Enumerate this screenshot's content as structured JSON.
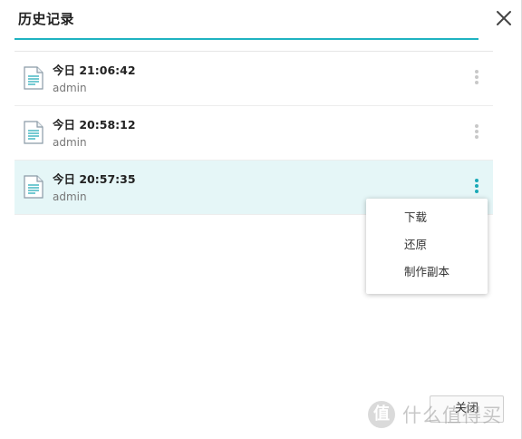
{
  "dialog": {
    "title": "历史记录",
    "close_icon": "close-icon",
    "accent": "#1fb3c1"
  },
  "records": [
    {
      "time": "今日 21:06:42",
      "user": "admin",
      "active": false
    },
    {
      "time": "今日 20:58:12",
      "user": "admin",
      "active": false
    },
    {
      "time": "今日 20:57:35",
      "user": "admin",
      "active": true
    }
  ],
  "context_menu": {
    "items": [
      "下载",
      "还原",
      "制作副本"
    ]
  },
  "footer": {
    "close_label": "关闭"
  },
  "watermark": {
    "logo": "值",
    "text": "什么值得买"
  }
}
